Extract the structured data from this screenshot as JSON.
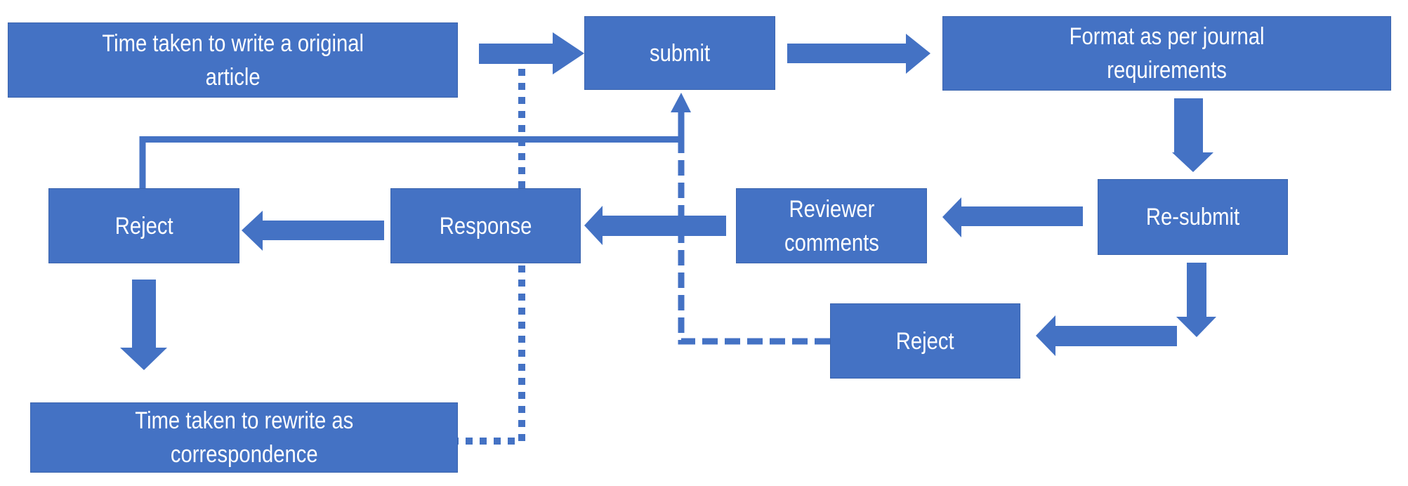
{
  "diagram": {
    "type": "flowchart",
    "colors": {
      "box_fill": "#4472C4",
      "box_text": "#FFFFFF",
      "connector": "#4472C4",
      "background": "#FFFFFF"
    },
    "nodes": [
      {
        "id": "write-original",
        "lines": [
          "Time taken to write a original",
          "article"
        ]
      },
      {
        "id": "submit",
        "lines": [
          "submit"
        ]
      },
      {
        "id": "format",
        "lines": [
          "Format as per journal",
          "requirements"
        ]
      },
      {
        "id": "resubmit",
        "lines": [
          "Re-submit"
        ]
      },
      {
        "id": "reviewer-comments",
        "lines": [
          "Reviewer",
          "comments"
        ]
      },
      {
        "id": "response",
        "lines": [
          "Response"
        ]
      },
      {
        "id": "reject-left",
        "lines": [
          "Reject"
        ]
      },
      {
        "id": "reject-right",
        "lines": [
          "Reject"
        ]
      },
      {
        "id": "rewrite-correspondence",
        "lines": [
          "Time taken to rewrite as",
          "correspondence"
        ]
      }
    ],
    "edges": [
      {
        "from": "write-original",
        "to": "submit",
        "style": "block-arrow"
      },
      {
        "from": "submit",
        "to": "format",
        "style": "block-arrow"
      },
      {
        "from": "format",
        "to": "resubmit",
        "style": "block-arrow"
      },
      {
        "from": "resubmit",
        "to": "reviewer-comments",
        "style": "block-arrow"
      },
      {
        "from": "reviewer-comments",
        "to": "response",
        "style": "block-arrow"
      },
      {
        "from": "response",
        "to": "reject-left",
        "style": "block-arrow"
      },
      {
        "from": "reject-left",
        "to": "rewrite-correspondence",
        "style": "block-arrow"
      },
      {
        "from": "resubmit",
        "to": "reject-right",
        "style": "block-arrow"
      },
      {
        "from": "reject-left",
        "to": "submit",
        "style": "solid-line"
      },
      {
        "from": "reject-right",
        "to": "submit",
        "style": "dashed-line"
      },
      {
        "from": "rewrite-correspondence",
        "to": "response",
        "style": "dotted-line"
      },
      {
        "from": "response",
        "to": "write-original-arrow",
        "style": "dotted-line"
      }
    ]
  }
}
